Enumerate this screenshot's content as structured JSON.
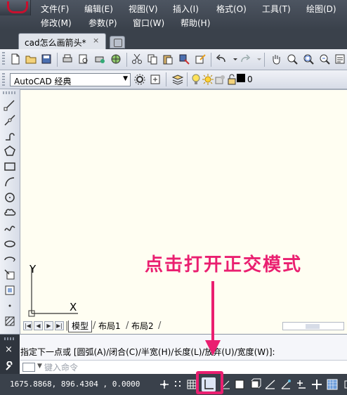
{
  "menubar": {
    "row1": [
      "文件(F)",
      "编辑(E)",
      "视图(V)",
      "插入(I)",
      "格式(O)",
      "工具(T)",
      "绘图(D)"
    ],
    "row2": [
      "修改(M)",
      "参数(P)",
      "窗口(W)",
      "帮助(H)"
    ]
  },
  "tabs": {
    "document": "cad怎么画箭头*",
    "close_glyph": "×"
  },
  "toolbar": {
    "workspace": "AutoCAD 经典",
    "dropdown_glyph": "▼",
    "layer_value": "0"
  },
  "canvas": {
    "ucs_y": "Y",
    "ucs_x": "X"
  },
  "layout_tabs": {
    "nav": [
      "|◀",
      "◀",
      "▶",
      "▶|"
    ],
    "tabs": [
      "模型",
      "布局1",
      "布局2"
    ]
  },
  "command": {
    "close_glyph": "×",
    "history": "指定下一点或 [圆弧(A)/闭合(C)/半宽(H)/长度(L)/放弃(U)/宽度(W)]:",
    "prompt_arrow": "▼",
    "placeholder": "键入命令"
  },
  "statusbar": {
    "coordinates": "1675.8868, 896.4304 , 0.0000"
  },
  "annotation": {
    "text": "点击打开正交模式",
    "color": "#ea1f70"
  }
}
